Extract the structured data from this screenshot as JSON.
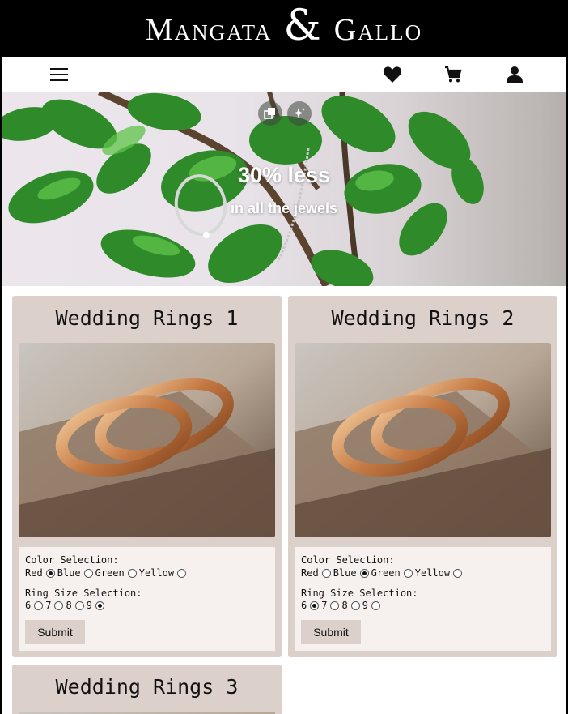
{
  "brand": {
    "name_1": "Mangata",
    "amp": "&",
    "name_2": "Gallo"
  },
  "nav": {
    "menu_icon": "hamburger-menu-icon",
    "icons": [
      "heart-icon",
      "shopping-cart-icon",
      "user-icon"
    ]
  },
  "hero": {
    "title": "30% less",
    "subtitle": "in all the jewels",
    "overlay_icons": [
      "visual-search-icon",
      "sparkle-icon"
    ]
  },
  "products": [
    {
      "title": "Wedding Rings 1",
      "color_label": "Color Selection:",
      "colors": [
        "Red",
        "Blue",
        "Green",
        "Yellow"
      ],
      "selected_color": "Red",
      "size_label": "Ring Size Selection:",
      "sizes": [
        "6",
        "7",
        "8",
        "9"
      ],
      "selected_size": "9",
      "submit_label": "Submit"
    },
    {
      "title": "Wedding Rings 2",
      "color_label": "Color Selection:",
      "colors": [
        "Red",
        "Blue",
        "Green",
        "Yellow"
      ],
      "selected_color": "Blue",
      "size_label": "Ring Size Selection:",
      "sizes": [
        "6",
        "7",
        "8",
        "9"
      ],
      "selected_size": "6",
      "submit_label": "Submit"
    },
    {
      "title": "Wedding Rings 3"
    }
  ],
  "colors": {
    "brand_bar": "#000000",
    "card_bg": "#dcd0ca",
    "form_bg": "#f6f1ef"
  }
}
